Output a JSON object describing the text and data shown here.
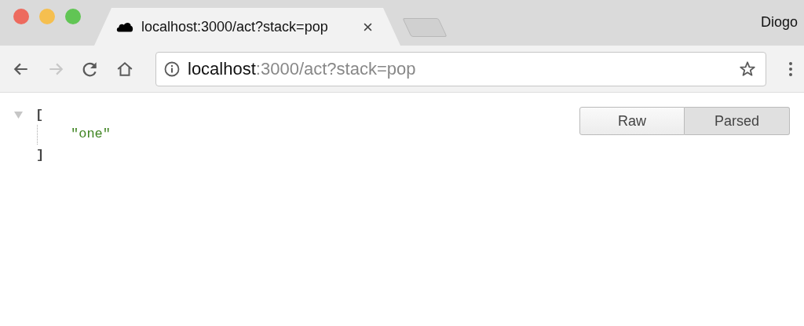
{
  "window": {
    "profile": "Diogo"
  },
  "tabs": [
    {
      "title": "localhost:3000/act?stack=pop",
      "selected": true
    }
  ],
  "toolbar": {
    "back_disabled": false,
    "forward_disabled": true,
    "address": {
      "host": "localhost",
      "rest": ":3000/act?stack=pop"
    }
  },
  "viewer": {
    "open": "[",
    "close": "]",
    "expanded": true,
    "items": [
      "\"one\""
    ],
    "modes": [
      {
        "label": "Raw",
        "selected": false
      },
      {
        "label": "Parsed",
        "selected": true
      }
    ]
  }
}
